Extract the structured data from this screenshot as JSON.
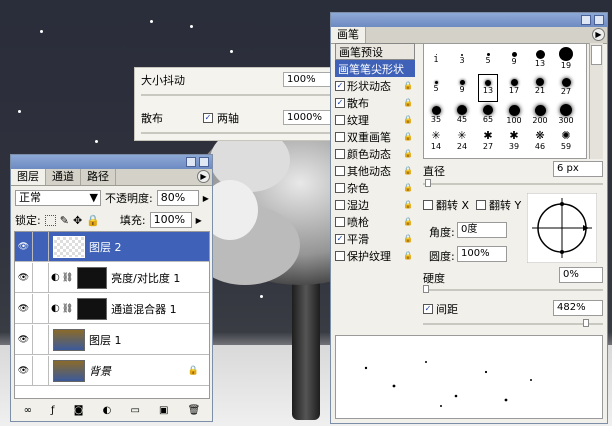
{
  "option_palette": {
    "size_jitter_label": "大小抖动",
    "size_jitter_value": "100%",
    "scatter_label": "散布",
    "both_axes_label": "两轴",
    "scatter_value": "1000%"
  },
  "layers_panel": {
    "tabs": [
      "图层",
      "通道",
      "路径"
    ],
    "blend_mode": "正常",
    "opacity_label": "不透明度:",
    "opacity_value": "80%",
    "lock_label": "锁定:",
    "fill_label": "填充:",
    "fill_value": "100%",
    "layers": [
      {
        "name": "图层 2"
      },
      {
        "name": "亮度/对比度 1"
      },
      {
        "name": "通道混合器 1"
      },
      {
        "name": "图层 1"
      },
      {
        "name": "背景"
      }
    ]
  },
  "brushes_panel": {
    "tab": "画笔",
    "presets_label": "画笔预设",
    "items": [
      {
        "label": "画笔笔尖形状",
        "checked": false
      },
      {
        "label": "形状动态",
        "checked": true
      },
      {
        "label": "散布",
        "checked": true
      },
      {
        "label": "纹理",
        "checked": false
      },
      {
        "label": "双重画笔",
        "checked": false
      },
      {
        "label": "颜色动态",
        "checked": false
      },
      {
        "label": "其他动态",
        "checked": false
      },
      {
        "label": "杂色",
        "checked": false
      },
      {
        "label": "湿边",
        "checked": false
      },
      {
        "label": "喷枪",
        "checked": false
      },
      {
        "label": "平滑",
        "checked": true
      },
      {
        "label": "保护纹理",
        "checked": false
      }
    ],
    "brush_sizes": [
      "1",
      "3",
      "5",
      "9",
      "13",
      "19",
      "5",
      "9",
      "13",
      "17",
      "21",
      "27",
      "35",
      "45",
      "65",
      "100",
      "200",
      "300",
      "14",
      "24",
      "27",
      "39",
      "46",
      "59"
    ],
    "diameter_label": "直径",
    "diameter_value": "6 px",
    "flip_x_label": "翻转 X",
    "flip_y_label": "翻转 Y",
    "angle_label": "角度:",
    "angle_value": "0度",
    "roundness_label": "圆度:",
    "roundness_value": "100%",
    "hardness_label": "硬度",
    "hardness_value": "0%",
    "spacing_label": "间距",
    "spacing_value": "482%"
  }
}
